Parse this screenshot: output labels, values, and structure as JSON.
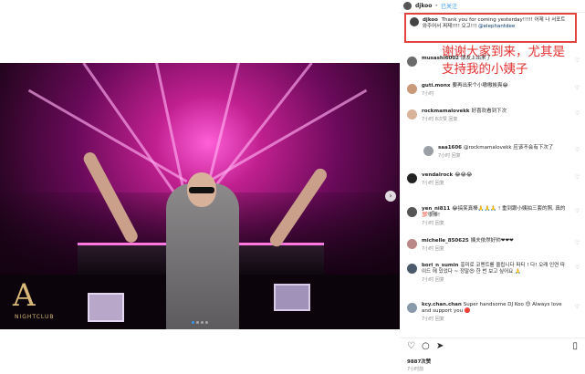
{
  "header": {
    "username": "djkoo",
    "follow_label": "已关注"
  },
  "caption": {
    "username": "djkoo",
    "text": "Thank you for coming yesterday!!!!! 어제 나 서포트 와주어서 쩌제!!!! 오고!!!",
    "mention": "@elephantdee"
  },
  "overlay": {
    "line1": "谢谢大家到来，尤其是",
    "line2": "支持我的小姨子"
  },
  "comments": [
    {
      "username": "musashi6002",
      "text": "朋友上出来了",
      "time": "",
      "avatar_color": "#6b6b6b",
      "reply": false
    },
    {
      "username": "guti.monx",
      "text": "要再出来个小嗷嗷挨爽😂",
      "time": "7小时",
      "avatar_color": "#c99a7a",
      "reply": false
    },
    {
      "username": "rockmamalovekk",
      "text": "好喜欢看到下次",
      "time": "7小时  8次赞  回复",
      "avatar_color": "#d8b39a",
      "reply": false
    },
    {
      "username": "saa1606",
      "text": "@rockmamalovekk 应该不会有下次了",
      "time": "7小时  回复",
      "avatar_color": "#9aa0a6",
      "reply": true
    },
    {
      "username": "vendalrock",
      "text": "😂😂😂",
      "time": "7小时  回复",
      "avatar_color": "#222222",
      "reply": false
    },
    {
      "username": "yen_ni811",
      "text": "😂搞笑真棒🙏🙏🙏  ! 重到跟小姨拍三套的照, 真的💯很棒!",
      "time": "7小时  回复",
      "avatar_color": "#555555",
      "reply": false
    },
    {
      "username": "michelle_850625",
      "text": "姨夫依然好帅❤❤❤",
      "time": "7小时  回复",
      "avatar_color": "#b88",
      "reply": false
    },
    {
      "username": "bori_n_sumin",
      "text": "흥미로 코멘트를 올립니다 파티 ! 다! 오래 인연 따이드 에 있었다 ~ 정말😍 한 번 보고 싶어요 🙏",
      "time": "7小时  回复",
      "avatar_color": "#4a5a6a",
      "reply": false
    },
    {
      "username": "kcy.chan.chan",
      "text": "Super handsome DJ Koo 😍 Always love and support you 🔴",
      "time": "7小时  回复",
      "avatar_color": "#8899aa",
      "reply": false
    },
    {
      "username": "",
      "text": "",
      "time": "",
      "avatar_color": "#ffffff",
      "reply": false
    }
  ],
  "footer": {
    "likes": "9887次赞",
    "time": "7小时前"
  },
  "photo": {
    "logo_text": "A",
    "logo_sub": "NIGHTCLUB"
  }
}
